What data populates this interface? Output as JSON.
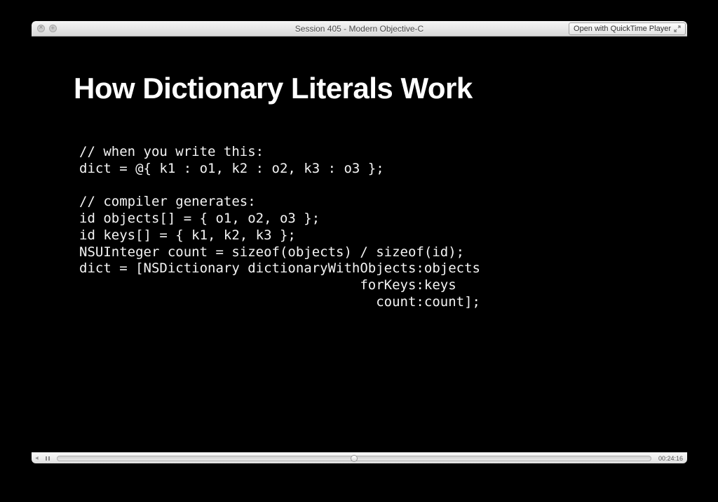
{
  "window": {
    "title": "Session 405 - Modern Objective-C",
    "open_with_label": "Open with QuickTime Player"
  },
  "slide": {
    "title": "How Dictionary Literals Work",
    "code": "// when you write this:\ndict = @{ k1 : o1, k2 : o2, k3 : o3 };\n\n// compiler generates:\nid objects[] = { o1, o2, o3 };\nid keys[] = { k1, k2, k3 };\nNSUInteger count = sizeof(objects) / sizeof(id);\ndict = [NSDictionary dictionaryWithObjects:objects\n                                   forKeys:keys\n                                     count:count];"
  },
  "player": {
    "timestamp": "00:24:16"
  }
}
